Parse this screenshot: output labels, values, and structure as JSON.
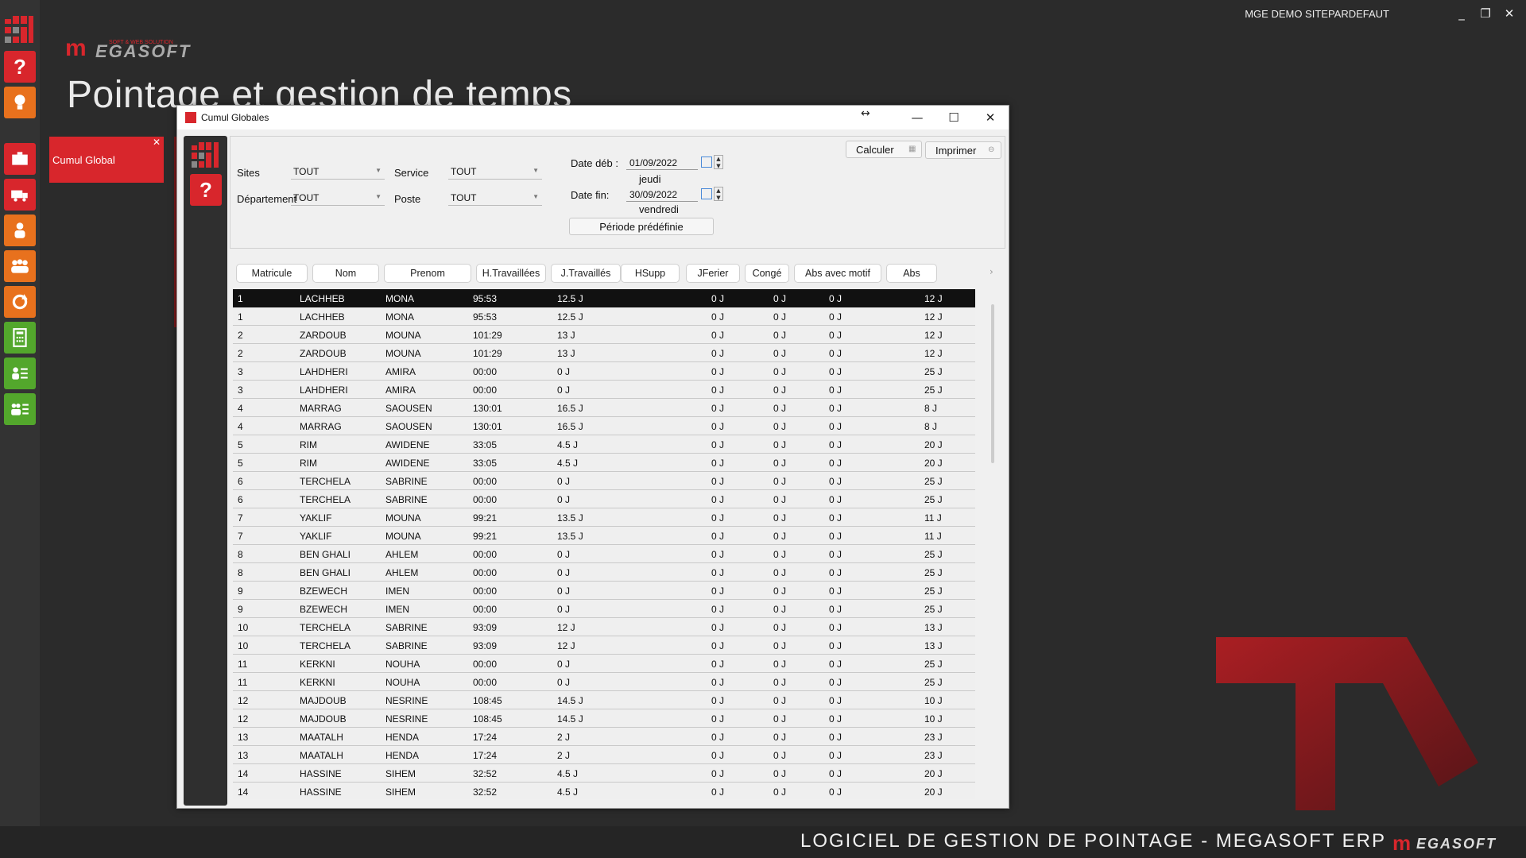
{
  "header": {
    "user_site": "MGE DEMO SITEPARDEFAUT",
    "page_title": "Pointage et gestion de temps",
    "brand_tagline": "SOFT & WEB SOLUTION",
    "brand_word": "EGASOFT"
  },
  "toolbar": {
    "items": [
      {
        "name": "help",
        "color": "red"
      },
      {
        "name": "idea",
        "color": "orange"
      },
      {
        "name": "briefcase",
        "color": "red"
      },
      {
        "name": "truck",
        "color": "red"
      },
      {
        "name": "person",
        "color": "orange"
      },
      {
        "name": "group",
        "color": "orange"
      },
      {
        "name": "refresh",
        "color": "orange"
      },
      {
        "name": "calculator",
        "color": "green"
      },
      {
        "name": "person-list",
        "color": "green"
      },
      {
        "name": "group-list",
        "color": "green"
      }
    ]
  },
  "tile": {
    "label": "Cumul Global",
    "close": "✕"
  },
  "footer": {
    "text": "LOGICIEL DE GESTION DE POINTAGE - MEGASOFT ERP",
    "brand": "EGASOFT"
  },
  "dialog": {
    "title": "Cumul Globales",
    "filters": {
      "sites_label": "Sites",
      "sites_value": "TOUT",
      "service_label": "Service",
      "service_value": "TOUT",
      "departement_label": "Département",
      "departement_value": "TOUT",
      "poste_label": "Poste",
      "poste_value": "TOUT",
      "date_deb_label": "Date déb :",
      "date_deb_value": "01/09/2022",
      "date_deb_day": "jeudi",
      "date_fin_label": "Date fin:",
      "date_fin_value": "30/09/2022",
      "date_fin_day": "vendredi",
      "periode_btn": "Période prédéfinie",
      "calculer_btn": "Calculer",
      "imprimer_btn": "Imprimer"
    },
    "columns": [
      "Matricule",
      "Nom",
      "Prenom",
      "H.Travaillées",
      "J.Travaillés",
      "HSupp",
      "JFerier",
      "Congé",
      "Abs avec motif",
      "Abs"
    ],
    "rows": [
      [
        "1",
        "LACHHEB",
        "MONA",
        "95:53",
        "12.5 J",
        "0 J",
        "0 J",
        "0 J",
        "12 J"
      ],
      [
        "1",
        "LACHHEB",
        "MONA",
        "95:53",
        "12.5 J",
        "0 J",
        "0 J",
        "0 J",
        "12 J"
      ],
      [
        "2",
        "ZARDOUB",
        "MOUNA",
        "101:29",
        "13 J",
        "0 J",
        "0 J",
        "0 J",
        "12 J"
      ],
      [
        "2",
        "ZARDOUB",
        "MOUNA",
        "101:29",
        "13 J",
        "0 J",
        "0 J",
        "0 J",
        "12 J"
      ],
      [
        "3",
        "LAHDHERI",
        "AMIRA",
        "00:00",
        "0 J",
        "0 J",
        "0 J",
        "0 J",
        "25 J"
      ],
      [
        "3",
        "LAHDHERI",
        "AMIRA",
        "00:00",
        "0 J",
        "0 J",
        "0 J",
        "0 J",
        "25 J"
      ],
      [
        "4",
        "MARRAG",
        "SAOUSEN",
        "130:01",
        "16.5 J",
        "0 J",
        "0 J",
        "0 J",
        "8 J"
      ],
      [
        "4",
        "MARRAG",
        "SAOUSEN",
        "130:01",
        "16.5 J",
        "0 J",
        "0 J",
        "0 J",
        "8 J"
      ],
      [
        "5",
        "RIM",
        "AWIDENE",
        "33:05",
        "4.5 J",
        "0 J",
        "0 J",
        "0 J",
        "20 J"
      ],
      [
        "5",
        "RIM",
        "AWIDENE",
        "33:05",
        "4.5 J",
        "0 J",
        "0 J",
        "0 J",
        "20 J"
      ],
      [
        "6",
        "TERCHELA",
        "SABRINE",
        "00:00",
        "0 J",
        "0 J",
        "0 J",
        "0 J",
        "25 J"
      ],
      [
        "6",
        "TERCHELA",
        "SABRINE",
        "00:00",
        "0 J",
        "0 J",
        "0 J",
        "0 J",
        "25 J"
      ],
      [
        "7",
        "YAKLIF",
        "MOUNA",
        "99:21",
        "13.5 J",
        "0 J",
        "0 J",
        "0 J",
        "11 J"
      ],
      [
        "7",
        "YAKLIF",
        "MOUNA",
        "99:21",
        "13.5 J",
        "0 J",
        "0 J",
        "0 J",
        "11 J"
      ],
      [
        "8",
        "BEN GHALI",
        "AHLEM",
        "00:00",
        "0 J",
        "0 J",
        "0 J",
        "0 J",
        "25 J"
      ],
      [
        "8",
        "BEN GHALI",
        "AHLEM",
        "00:00",
        "0 J",
        "0 J",
        "0 J",
        "0 J",
        "25 J"
      ],
      [
        "9",
        "BZEWECH",
        "IMEN",
        "00:00",
        "0 J",
        "0 J",
        "0 J",
        "0 J",
        "25 J"
      ],
      [
        "9",
        "BZEWECH",
        "IMEN",
        "00:00",
        "0 J",
        "0 J",
        "0 J",
        "0 J",
        "25 J"
      ],
      [
        "10",
        "TERCHELA",
        "SABRINE",
        "93:09",
        "12 J",
        "0 J",
        "0 J",
        "0 J",
        "13 J"
      ],
      [
        "10",
        "TERCHELA",
        "SABRINE",
        "93:09",
        "12 J",
        "0 J",
        "0 J",
        "0 J",
        "13 J"
      ],
      [
        "11",
        "KERKNI",
        "NOUHA",
        "00:00",
        "0 J",
        "0 J",
        "0 J",
        "0 J",
        "25 J"
      ],
      [
        "11",
        "KERKNI",
        "NOUHA",
        "00:00",
        "0 J",
        "0 J",
        "0 J",
        "0 J",
        "25 J"
      ],
      [
        "12",
        "MAJDOUB",
        "NESRINE",
        "108:45",
        "14.5 J",
        "0 J",
        "0 J",
        "0 J",
        "10 J"
      ],
      [
        "12",
        "MAJDOUB",
        "NESRINE",
        "108:45",
        "14.5 J",
        "0 J",
        "0 J",
        "0 J",
        "10 J"
      ],
      [
        "13",
        "MAATALH",
        "HENDA",
        "17:24",
        "2 J",
        "0 J",
        "0 J",
        "0 J",
        "23 J"
      ],
      [
        "13",
        "MAATALH",
        "HENDA",
        "17:24",
        "2 J",
        "0 J",
        "0 J",
        "0 J",
        "23 J"
      ],
      [
        "14",
        "HASSINE",
        "SIHEM",
        "32:52",
        "4.5 J",
        "0 J",
        "0 J",
        "0 J",
        "20 J"
      ],
      [
        "14",
        "HASSINE",
        "SIHEM",
        "32:52",
        "4.5 J",
        "0 J",
        "0 J",
        "0 J",
        "20 J"
      ]
    ]
  }
}
